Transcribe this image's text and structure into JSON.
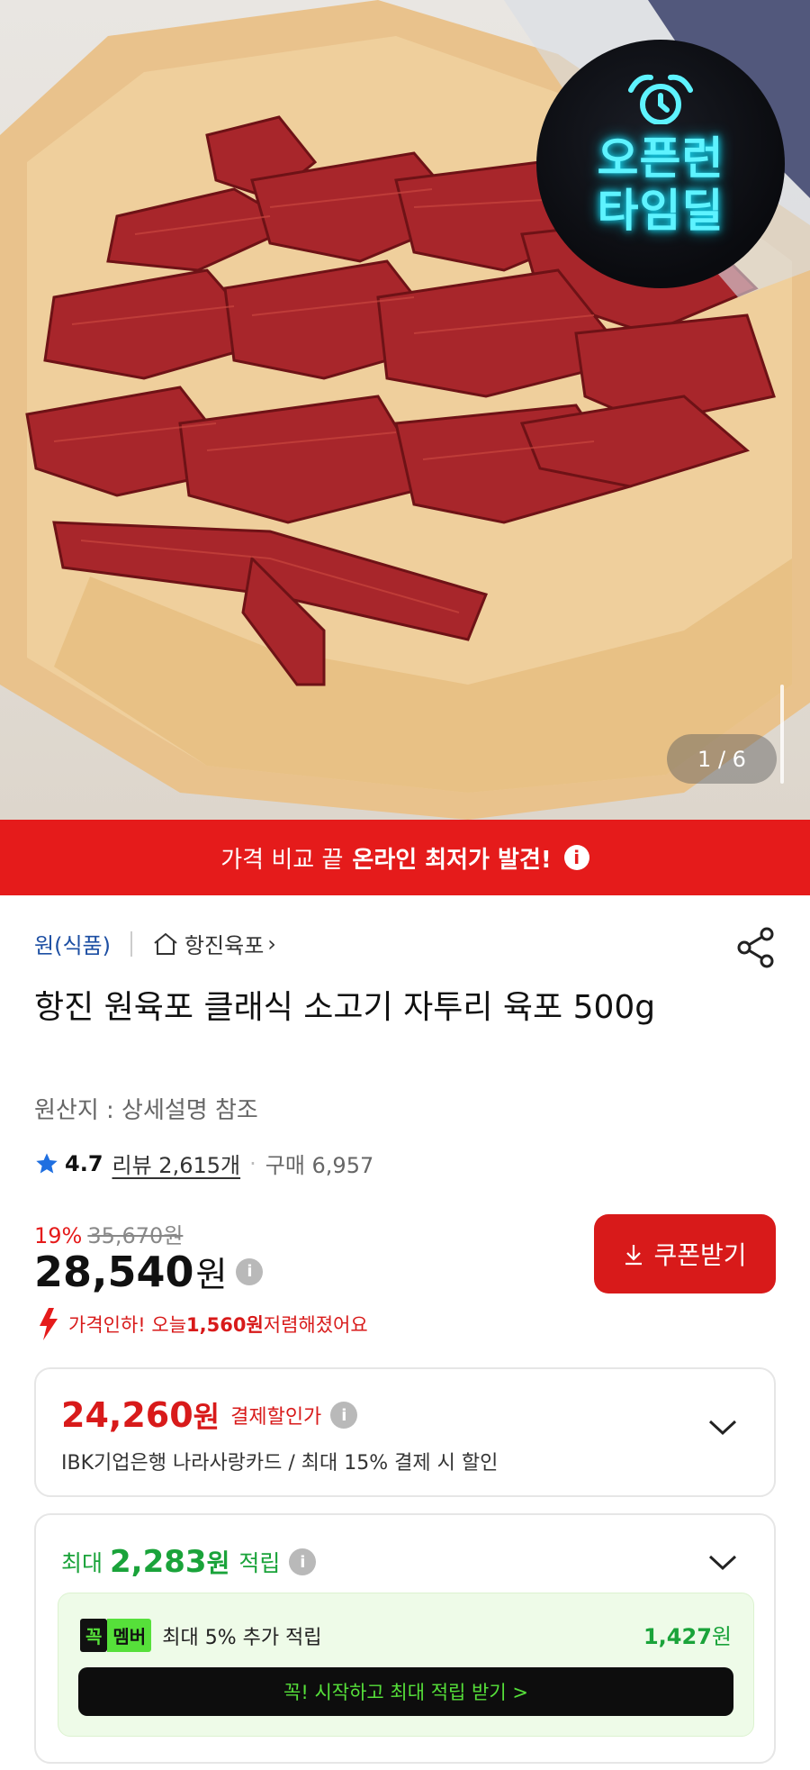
{
  "hero": {
    "badge_line1": "오픈런",
    "badge_line2": "타임딜",
    "image_counter": "1 / 6"
  },
  "banner": {
    "text_normal": "가격 비교 끝",
    "text_bold": "온라인 최저가 발견!",
    "info_icon": "i"
  },
  "breadcrumb": {
    "category": "원(식품)",
    "store": "항진육포",
    "store_chevron": "›"
  },
  "product": {
    "title": "항진 원육포 클래식 소고기 자투리 육포 500g",
    "origin": "원산지 : 상세설명 참조",
    "rating": "4.7",
    "review_label": "리뷰 2,615개",
    "dot": "·",
    "purchase_label": "구매 6,957",
    "discount_pct": "19%",
    "original_price": "35,670원",
    "price_num": "28,540",
    "price_won": "원",
    "coupon_button": "쿠폰받기",
    "price_drop_prefix": "가격인하! 오늘 ",
    "price_drop_amount": "1,560원",
    "price_drop_suffix": " 저렴해졌어요"
  },
  "payment_discount": {
    "amount": "24,260",
    "won": "원",
    "label": "결제할인가",
    "description": "IBK기업은행 나라사랑카드 / 최대 15% 결제 시 할인"
  },
  "points": {
    "prefix": "최대",
    "amount": "2,283",
    "won": "원",
    "label": "적립",
    "member_tag1": "꼭",
    "member_tag2": "멤버",
    "member_text": "최대 5% 추가 적립",
    "member_points": "1,427",
    "member_points_won": "원",
    "start_button": "꼭! 시작하고 최대 적립 받기 >"
  },
  "colors": {
    "accent_red": "#e51b1b",
    "points_green": "#1aa33a",
    "member_green": "#56e03a",
    "neon_cyan": "#5ef3ff"
  }
}
